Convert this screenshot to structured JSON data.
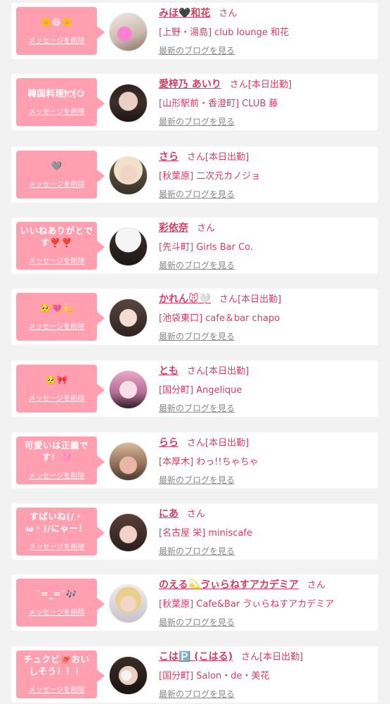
{
  "delete_label": "メッセージを削除",
  "blog_link_label": "最新のブログを見る",
  "honorific": "さん",
  "colors": {
    "accent": "#d63d63",
    "bubble": "#ff9fb0",
    "background": "#f2f2f2"
  },
  "items": [
    {
      "message": "🌼😆🌼",
      "name": "みほ🖤和花",
      "status": "",
      "shop": "[上野・湯島] club lounge 和花"
    },
    {
      "message": "韓国料理🍽😋",
      "name": "愛梓乃 あいり",
      "status": "[本日出勤]",
      "shop": "[山形駅前・香澄町] CLUB 藤"
    },
    {
      "message": "🩶",
      "name": "さら",
      "status": "[本日出勤]",
      "shop": "[秋葉原] 二次元カノジョ"
    },
    {
      "message": "いいねありがとです❣️❣️",
      "name": "彩依奈",
      "status": "",
      "shop": "[先斗町] Girls Bar Co."
    },
    {
      "message": "🥺💘💫",
      "name": "かれん🐭🤍",
      "status": "[本日出勤]",
      "shop": "[池袋東口] cafe＆bar chapo"
    },
    {
      "message": "🥺🎀",
      "name": "とも",
      "status": "[本日出勤]",
      "shop": "[国分町] Angelique"
    },
    {
      "message": "可愛いは正義です！🩷",
      "name": "らら",
      "status": "[本日出勤]",
      "shop": "[本厚木] わっ!!ちゃちゃ"
    },
    {
      "message": "すばいね(/・ω・)/にゃー！",
      "name": "にあ",
      "status": "",
      "shop": "[名古屋 栄] miniscafe"
    },
    {
      "message": "˘=_=˘🎶",
      "name": "のえる💫ゔぃらねすアカデミア",
      "status": "",
      "shop": "[秋葉原] Cafe&Bar ゔぃらねすアカデミア"
    },
    {
      "message": "チュクビ🐙おいしそう！！！",
      "name": "こは🅿️ (こはる)",
      "status": "[本日出勤]",
      "shop": "[国分町] Salon・de・美花"
    }
  ]
}
